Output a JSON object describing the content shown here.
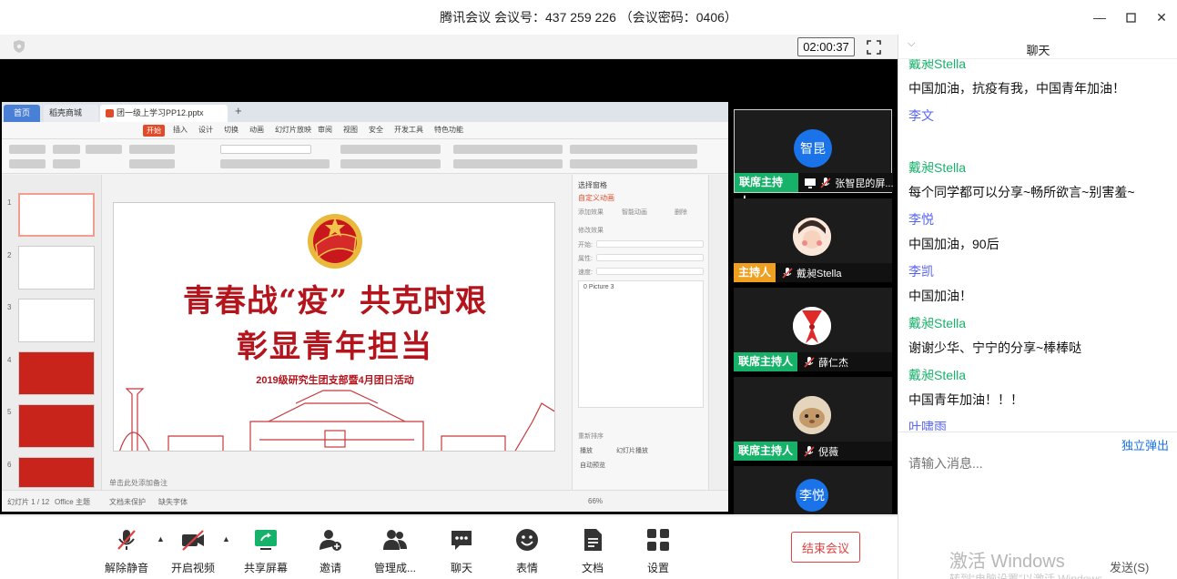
{
  "window": {
    "title": "腾讯会议 会议号：437 259 226 （会议密码：0406）"
  },
  "meeting": {
    "timer": "02:00:37"
  },
  "shared_screen": {
    "tabs": [
      "首页",
      "稻壳商城",
      "团一级上学习PP12.pptx"
    ],
    "menu": [
      "开始",
      "插入",
      "设计",
      "切换",
      "动画",
      "幻灯片放映",
      "审阅",
      "视图",
      "安全",
      "开发工具",
      "特色功能"
    ],
    "thumb_numbers": [
      "1",
      "2",
      "3",
      "4",
      "5",
      "6"
    ],
    "slide": {
      "title_line1": "青春战“疫” 共克时艰",
      "title_line2": "彰显青年担当",
      "subtitle": "2019级研究生团支部暨4月团日活动"
    },
    "anim_pane": {
      "title": "自定义动画",
      "items": [
        "选择窗格",
        "自定义动画",
        "添加效果",
        "智能动画",
        "删除",
        "修改效果",
        "开始:",
        "属性:",
        "速度:",
        "0  Picture 3",
        "重新排序",
        "播放",
        "幻灯片播放",
        "自动预览"
      ]
    },
    "notes": "单击此处添加备注",
    "status": [
      "幻灯片 1 / 12",
      "Office 主题",
      "文档未保护",
      "缺失字体"
    ],
    "zoom": "66%"
  },
  "participants": [
    {
      "avatar_text": "智昆",
      "role": "联席主持人",
      "name": "张智昆的屏..."
    },
    {
      "avatar_text": "",
      "role": "主持人",
      "name": "戴昶Stella"
    },
    {
      "avatar_text": "",
      "role": "联席主持人",
      "name": "薛仁杰"
    },
    {
      "avatar_text": "",
      "role": "联席主持人",
      "name": "倪薇"
    },
    {
      "avatar_text": "李悦",
      "role": "",
      "name": ""
    }
  ],
  "toolbar": {
    "unmute": "解除静音",
    "start_video": "开启视频",
    "share_screen": "共享屏幕",
    "invite": "邀请",
    "manage_members": "管理成...",
    "chat": "聊天",
    "reactions": "表情",
    "docs": "文档",
    "settings": "设置",
    "end_meeting": "结束会议"
  },
  "chat": {
    "title": "聊天",
    "messages": [
      {
        "sender": "戴昶Stella",
        "color": "#17b26a",
        "text": "中国加油，抗疫有我，中国青年加油！"
      },
      {
        "sender": "李文",
        "color": "#5865f2",
        "text": ""
      },
      {
        "sender": "戴昶Stella",
        "color": "#17b26a",
        "text": "每个同学都可以分享~畅所欲言~别害羞~"
      },
      {
        "sender": "李悦",
        "color": "#5865f2",
        "text": "中国加油，90后"
      },
      {
        "sender": "李凯",
        "color": "#5865f2",
        "text": "中国加油！"
      },
      {
        "sender": "戴昶Stella",
        "color": "#17b26a",
        "text": "谢谢少华、宁宁的分享~棒棒哒"
      },
      {
        "sender": "戴昶Stella",
        "color": "#17b26a",
        "text": "中国青年加油！！！"
      },
      {
        "sender": "叶啸雨",
        "color": "#5865f2",
        "text": ""
      }
    ],
    "popout": "独立弹出",
    "input_placeholder": "请输入消息...",
    "send": "发送(S)",
    "watermark": "激活 Windows",
    "watermark_sub": "转到“电脑设置”以激活 Windows。"
  }
}
